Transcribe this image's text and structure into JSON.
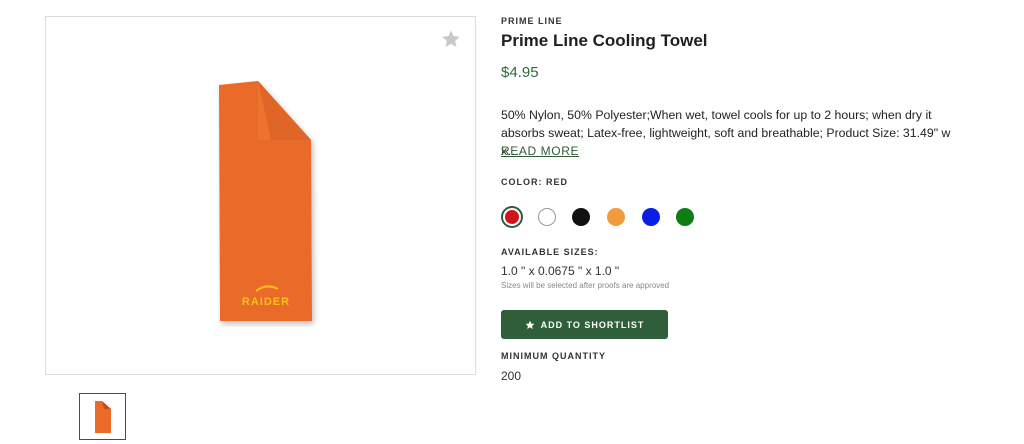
{
  "product": {
    "brand": "PRIME LINE",
    "title": "Prime Line Cooling Towel",
    "price": "$4.95",
    "description": "50% Nylon, 50% Polyester;When wet, towel cools for up to 2 hours; when dry it absorbs sweat; Latex-free, lightweight, soft and breathable; Product Size: 31.49\" w x…",
    "read_more": "READ MORE",
    "image_logo_text": "RAIDER"
  },
  "color": {
    "label": "COLOR: RED",
    "selected": "red",
    "swatches": [
      {
        "name": "red",
        "hex": "#d0141c"
      },
      {
        "name": "white",
        "hex": "#ffffff"
      },
      {
        "name": "black",
        "hex": "#111111"
      },
      {
        "name": "orange",
        "hex": "#f39a3d"
      },
      {
        "name": "blue",
        "hex": "#0a1fe6"
      },
      {
        "name": "green",
        "hex": "#0f7d14"
      }
    ]
  },
  "sizes": {
    "label": "AVAILABLE SIZES:",
    "value": "1.0 \" x 0.0675 \" x 1.0 \"",
    "note": "Sizes will be selected after proofs are approved"
  },
  "actions": {
    "shortlist_label": "ADD TO SHORTLIST"
  },
  "minimum": {
    "label": "MINIMUM QUANTITY",
    "value": "200"
  },
  "colors": {
    "accent": "#2e5e3a",
    "price": "#2f6b3a",
    "towel": "#ea6a2a"
  }
}
